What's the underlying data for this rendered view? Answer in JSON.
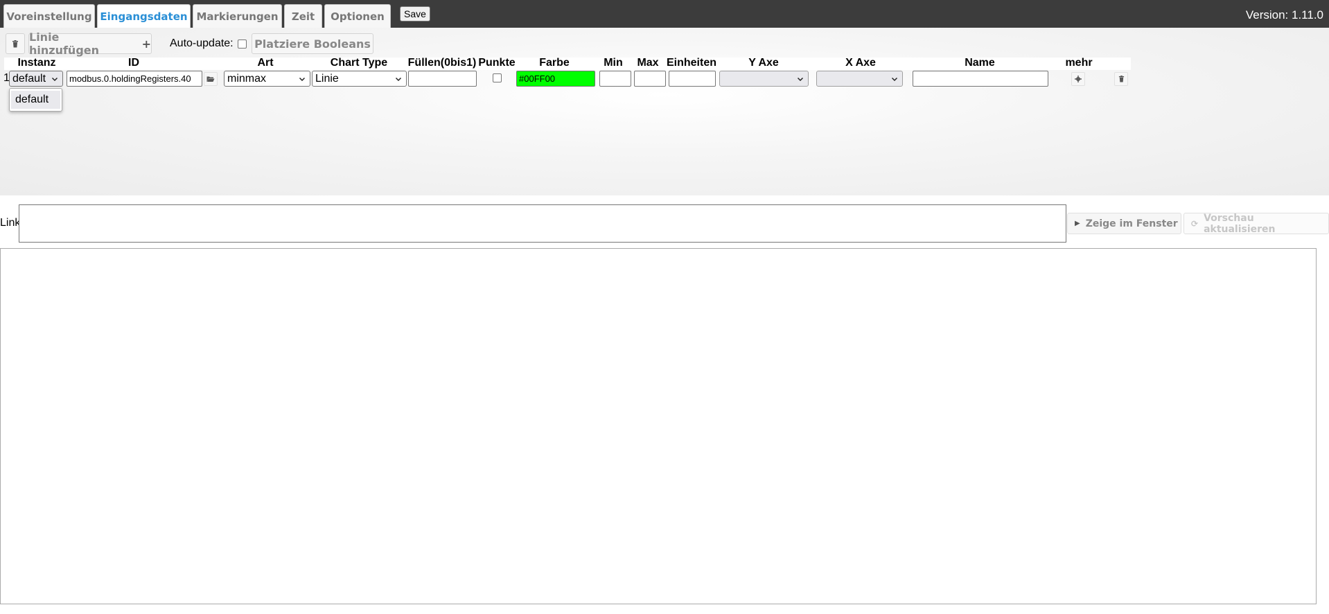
{
  "tabs": [
    {
      "label": "Voreinstellung",
      "active": false
    },
    {
      "label": "Eingangsdaten",
      "active": true
    },
    {
      "label": "Markierungen",
      "active": false
    },
    {
      "label": "Zeit",
      "active": false
    },
    {
      "label": "Optionen",
      "active": false
    }
  ],
  "toolbar": {
    "save_label": "Save",
    "version": "Version: 1.11.0"
  },
  "data_panel": {
    "add_line_label": "Linie hinzufügen",
    "add_icon": "plus-icon",
    "delete_icon": "trash-icon",
    "auto_update_label": "Auto-update:",
    "auto_update_checked": false,
    "place_booleans_label": "Platziere Booleans"
  },
  "columns": [
    "Instanz",
    "ID",
    "Art",
    "Chart Type",
    "Füllen(0bis1)",
    "Punkte",
    "Farbe",
    "Min",
    "Max",
    "Einheiten",
    "Y Axe",
    "X Axe",
    "Name",
    "mehr"
  ],
  "rows": [
    {
      "index": "1",
      "instance": "default",
      "id": "modbus.0.holdingRegisters.40",
      "art": "minmax",
      "chart_type": "Linie",
      "fill": "",
      "points_checked": false,
      "color": "#00FF00",
      "min": "",
      "max": "",
      "units": "",
      "y_axis": "",
      "x_axis": "",
      "name": ""
    }
  ],
  "instance_dropdown": {
    "open": true,
    "options": [
      "default"
    ]
  },
  "link_section": {
    "label": "Link",
    "value": "",
    "show_window_label": "Zeige im Fenster",
    "refresh_preview_label": "Vorschau aktualisieren"
  },
  "colors": {
    "tabbar_bg": "#3c3c3c",
    "active_tab": "#2a8fd6",
    "color_swatch": "#00FF00"
  }
}
